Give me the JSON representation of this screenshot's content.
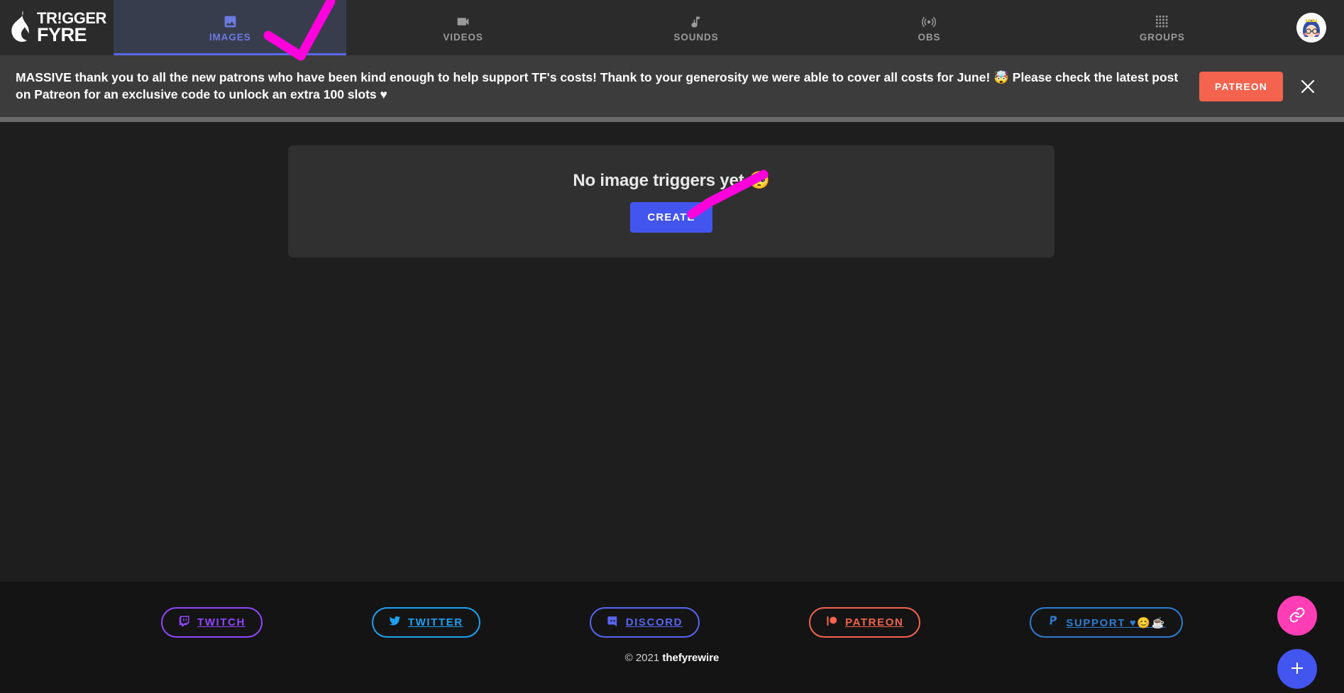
{
  "brand": {
    "name_line1": "TR!GGER",
    "name_line2": "FYRE",
    "logo_icon": "flame-icon"
  },
  "nav": {
    "tabs": [
      {
        "label": "IMAGES",
        "icon": "image-icon",
        "active": true
      },
      {
        "label": "VIDEOS",
        "icon": "video-camera-icon",
        "active": false
      },
      {
        "label": "SOUNDS",
        "icon": "music-note-icon",
        "active": false
      },
      {
        "label": "OBS",
        "icon": "broadcast-icon",
        "active": false
      },
      {
        "label": "GROUPS",
        "icon": "grid-dots-icon",
        "active": false
      }
    ],
    "avatar_alt": "user-avatar",
    "active_color": "#6c7ae0",
    "active_bg": "#383d4e"
  },
  "banner": {
    "message_line1": "MASSIVE thank you to all the new patrons who have been kind enough to help support TF's costs! Thank to your generosity we were able to cover all costs for June! 🤯 Please check the latest post",
    "message_line2": "on Patreon for an exclusive code to unlock an extra 100 slots ♥",
    "cta_label": "PATREON",
    "cta_color": "#f4634e",
    "close_icon": "close-icon"
  },
  "main": {
    "empty_title": "No image triggers yet 🥺",
    "create_label": "CREATE",
    "create_color": "#4355ef"
  },
  "footer": {
    "socials": [
      {
        "label": "TWITCH",
        "icon": "twitch-icon",
        "color": "#9146ff"
      },
      {
        "label": "TWITTER",
        "icon": "twitter-icon",
        "color": "#1da1f2"
      },
      {
        "label": "DISCORD",
        "icon": "discord-icon",
        "color": "#5865f2"
      },
      {
        "label": "PATREON",
        "icon": "patreon-icon",
        "color": "#f4634e"
      },
      {
        "label": "SUPPORT ♥😊☕",
        "icon": "paypal-icon",
        "color": "#2d7dd2"
      }
    ],
    "copyright_prefix": "© 2021 ",
    "copyright_brand": "thefyrewire"
  },
  "fabs": [
    {
      "name": "link-fab",
      "icon": "link-icon",
      "color": "#ff3eb5"
    },
    {
      "name": "add-fab",
      "icon": "plus-icon",
      "color": "#4355ef"
    }
  ],
  "annotations": {
    "color": "#ff00dd",
    "marks": [
      "checkmark-over-images-tab",
      "arrow-to-create-button"
    ]
  }
}
